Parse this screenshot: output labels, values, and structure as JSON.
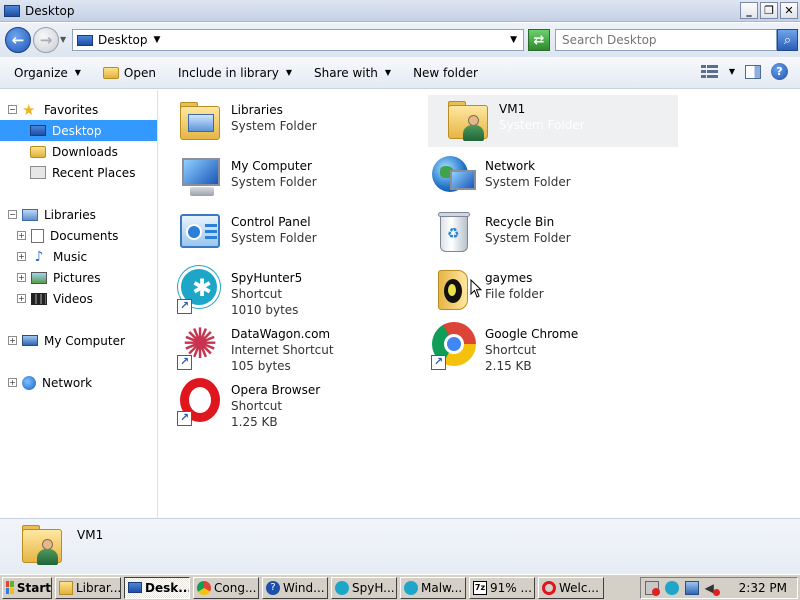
{
  "window": {
    "title": "Desktop"
  },
  "address": {
    "location": "Desktop",
    "search_placeholder": "Search Desktop"
  },
  "toolbar": {
    "organize": "Organize",
    "open": "Open",
    "include_in_library": "Include in library",
    "share_with": "Share with",
    "new_folder": "New folder"
  },
  "nav": {
    "favorites": "Favorites",
    "desktop": "Desktop",
    "downloads": "Downloads",
    "recent_places": "Recent Places",
    "libraries": "Libraries",
    "documents": "Documents",
    "music": "Music",
    "pictures": "Pictures",
    "videos": "Videos",
    "my_computer": "My Computer",
    "network": "Network"
  },
  "items": [
    {
      "name": "Libraries",
      "type": "System Folder",
      "size": ""
    },
    {
      "name": "VM1",
      "type": "System Folder",
      "size": ""
    },
    {
      "name": "My Computer",
      "type": "System Folder",
      "size": ""
    },
    {
      "name": "Network",
      "type": "System Folder",
      "size": ""
    },
    {
      "name": "Control Panel",
      "type": "System Folder",
      "size": ""
    },
    {
      "name": "Recycle Bin",
      "type": "System Folder",
      "size": ""
    },
    {
      "name": "SpyHunter5",
      "type": "Shortcut",
      "size": "1010 bytes"
    },
    {
      "name": "gaymes",
      "type": "File folder",
      "size": ""
    },
    {
      "name": "DataWagon.com",
      "type": "Internet Shortcut",
      "size": "105 bytes"
    },
    {
      "name": "Google Chrome",
      "type": "Shortcut",
      "size": "2.15 KB"
    },
    {
      "name": "Opera Browser",
      "type": "Shortcut",
      "size": "1.25 KB"
    }
  ],
  "details": {
    "name": "VM1"
  },
  "taskbar": {
    "start": "Start",
    "buttons": [
      "Librar...",
      "Desk...",
      "Cong...",
      "Wind...",
      "SpyH...",
      "Malw...",
      "91% ...",
      "Welc..."
    ],
    "clock": "2:32 PM"
  }
}
